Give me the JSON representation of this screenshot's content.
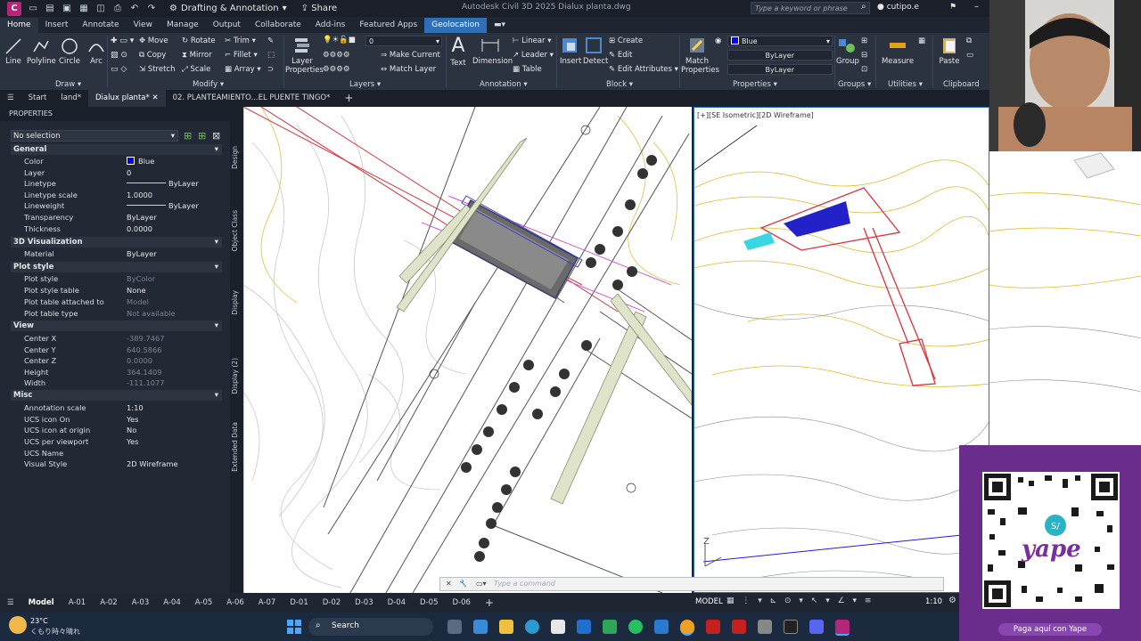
{
  "titlebar": {
    "workspace": "Drafting & Annotation",
    "share": "Share",
    "window_title": "Autodesk Civil 3D 2025   Dialux planta.dwg",
    "search_placeholder": "Type a keyword or phrase",
    "user": "cutipo.e"
  },
  "ribbon_tabs": [
    "Home",
    "Insert",
    "Annotate",
    "View",
    "Manage",
    "Output",
    "Collaborate",
    "Add-ins",
    "Featured Apps",
    "Geolocation"
  ],
  "ribbon": {
    "draw": {
      "line": "Line",
      "polyline": "Polyline",
      "circle": "Circle",
      "arc": "Arc",
      "label": "Draw"
    },
    "modify": {
      "move": "Move",
      "rotate": "Rotate",
      "trim": "Trim",
      "copy": "Copy",
      "mirror": "Mirror",
      "fillet": "Fillet",
      "stretch": "Stretch",
      "scale": "Scale",
      "array": "Array",
      "label": "Modify"
    },
    "layers": {
      "layer_properties": "Layer Properties",
      "current": "0",
      "make_current": "Make Current",
      "match_layer": "Match Layer",
      "label": "Layers"
    },
    "annotation": {
      "text": "Text",
      "dimension": "Dimension",
      "linear": "Linear",
      "leader": "Leader",
      "table": "Table",
      "label": "Annotation"
    },
    "block": {
      "insert": "Insert",
      "detect": "Detect",
      "create": "Create",
      "edit": "Edit",
      "edit_attributes": "Edit Attributes",
      "label": "Block"
    },
    "properties": {
      "match_properties": "Match Properties",
      "color": "Blue",
      "linetype": "ByLayer",
      "lineweight": "ByLayer",
      "label": "Properties"
    },
    "groups": {
      "group": "Group",
      "label": "Groups"
    },
    "utilities": {
      "measure": "Measure",
      "label": "Utilities"
    },
    "clipboard": {
      "paste": "Paste",
      "label": "Clipboard"
    }
  },
  "file_tabs": [
    "Start",
    "land*",
    "Dialux planta*",
    "02. PLANTEAMIENTO...EL PUENTE TINGO*"
  ],
  "properties_palette": {
    "title": "PROPERTIES",
    "selection": "No selection",
    "sections": {
      "general": "General",
      "vis3d": "3D Visualization",
      "plotstyle": "Plot style",
      "view": "View",
      "misc": "Misc"
    },
    "general": [
      {
        "k": "Color",
        "v": "Blue"
      },
      {
        "k": "Layer",
        "v": "0"
      },
      {
        "k": "Linetype",
        "v": "ByLayer"
      },
      {
        "k": "Linetype scale",
        "v": "1.0000"
      },
      {
        "k": "Lineweight",
        "v": "ByLayer"
      },
      {
        "k": "Transparency",
        "v": "ByLayer"
      },
      {
        "k": "Thickness",
        "v": "0.0000"
      }
    ],
    "vis3d": [
      {
        "k": "Material",
        "v": "ByLayer"
      }
    ],
    "plotstyle": [
      {
        "k": "Plot style",
        "v": "ByColor"
      },
      {
        "k": "Plot style table",
        "v": "None"
      },
      {
        "k": "Plot table attached to",
        "v": "Model"
      },
      {
        "k": "Plot table type",
        "v": "Not available"
      }
    ],
    "view": [
      {
        "k": "Center X",
        "v": "-389.7467"
      },
      {
        "k": "Center Y",
        "v": "640.5866"
      },
      {
        "k": "Center Z",
        "v": "0.0000"
      },
      {
        "k": "Height",
        "v": "364.1409"
      },
      {
        "k": "Width",
        "v": "-111.1077"
      }
    ],
    "misc": [
      {
        "k": "Annotation scale",
        "v": "1:10"
      },
      {
        "k": "UCS icon On",
        "v": "Yes"
      },
      {
        "k": "UCS icon at origin",
        "v": "No"
      },
      {
        "k": "UCS per viewport",
        "v": "Yes"
      },
      {
        "k": "UCS Name",
        "v": ""
      },
      {
        "k": "Visual Style",
        "v": "2D Wireframe"
      }
    ],
    "side_tabs": [
      "Design",
      "Object Class",
      "Display",
      "Display (2)",
      "Extended Data"
    ]
  },
  "viewport2_label": "[+][SE Isometric][2D Wireframe]",
  "command_placeholder": "Type a command",
  "layout_tabs": [
    "Model",
    "A-01",
    "A-02",
    "A-03",
    "A-04",
    "A-05",
    "A-06",
    "A-07",
    "D-01",
    "D-02",
    "D-03",
    "D-04",
    "D-05",
    "D-06"
  ],
  "status": {
    "model": "MODEL",
    "scale": "1:10"
  },
  "taskbar": {
    "weather_temp": "23°C",
    "weather_desc": "くもり時々晴れ",
    "search": "Search"
  },
  "qr": {
    "brand": "yape",
    "cta": "Paga aquí con Yape"
  },
  "colors": {
    "accent": "#2f6fb8",
    "panel_bg": "#222935",
    "ribbon_bg": "#2b3240",
    "yape": "#6b2d8c"
  }
}
